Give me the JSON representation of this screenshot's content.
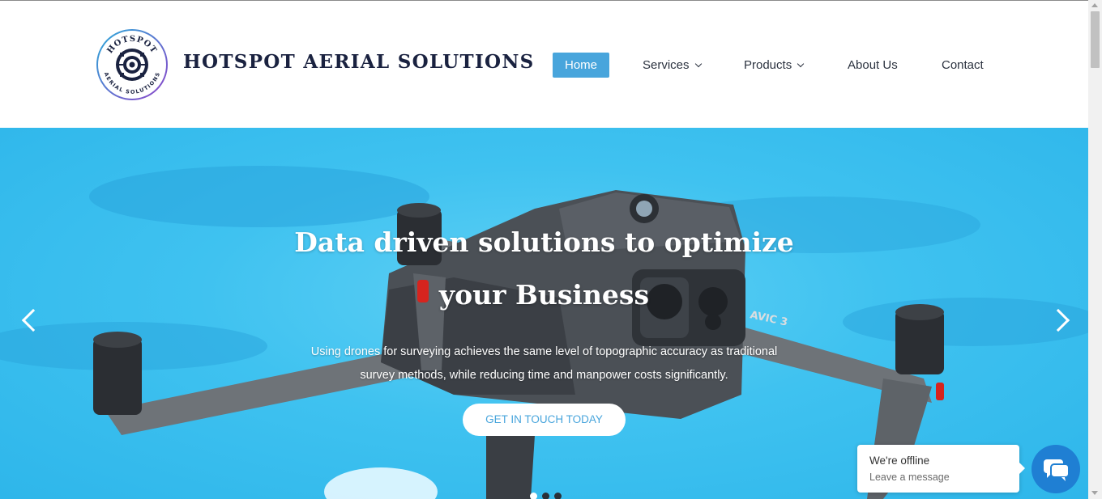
{
  "header": {
    "brand_name": "HOTSPOT AERIAL SOLUTIONS",
    "logo_text_top": "HOTSPOT",
    "logo_text_bottom": "AERIAL SOLUTIONS"
  },
  "nav": {
    "items": [
      {
        "label": "Home",
        "active": true,
        "has_dropdown": false
      },
      {
        "label": "Services",
        "active": false,
        "has_dropdown": true
      },
      {
        "label": "Products",
        "active": false,
        "has_dropdown": true
      },
      {
        "label": "About Us",
        "active": false,
        "has_dropdown": false
      },
      {
        "label": "Contact",
        "active": false,
        "has_dropdown": false
      }
    ]
  },
  "hero": {
    "headline_line1": "Data driven solutions to optimize",
    "headline_line2": "your Business",
    "subtext_line1": "Using drones for surveying achieves the same level of topographic accuracy as traditional",
    "subtext_line2": "survey methods, while reducing time and manpower costs significantly.",
    "cta_label": "GET IN TOUCH TODAY",
    "drone_model_text": "AVIC 3",
    "slides_total": 3,
    "slide_active_index": 0
  },
  "chat": {
    "status": "We're offline",
    "prompt": "Leave a message"
  },
  "colors": {
    "brand_navy": "#1a2240",
    "accent_blue": "#48a5dc",
    "hero_sky": "#3fc2f0",
    "chat_blue": "#1f7fd3"
  },
  "icons": {
    "logo": "target-crosshair-logo",
    "prev": "chevron-left-icon",
    "next": "chevron-right-icon",
    "chat": "chat-bubbles-icon",
    "dropdown": "chevron-down-icon"
  }
}
